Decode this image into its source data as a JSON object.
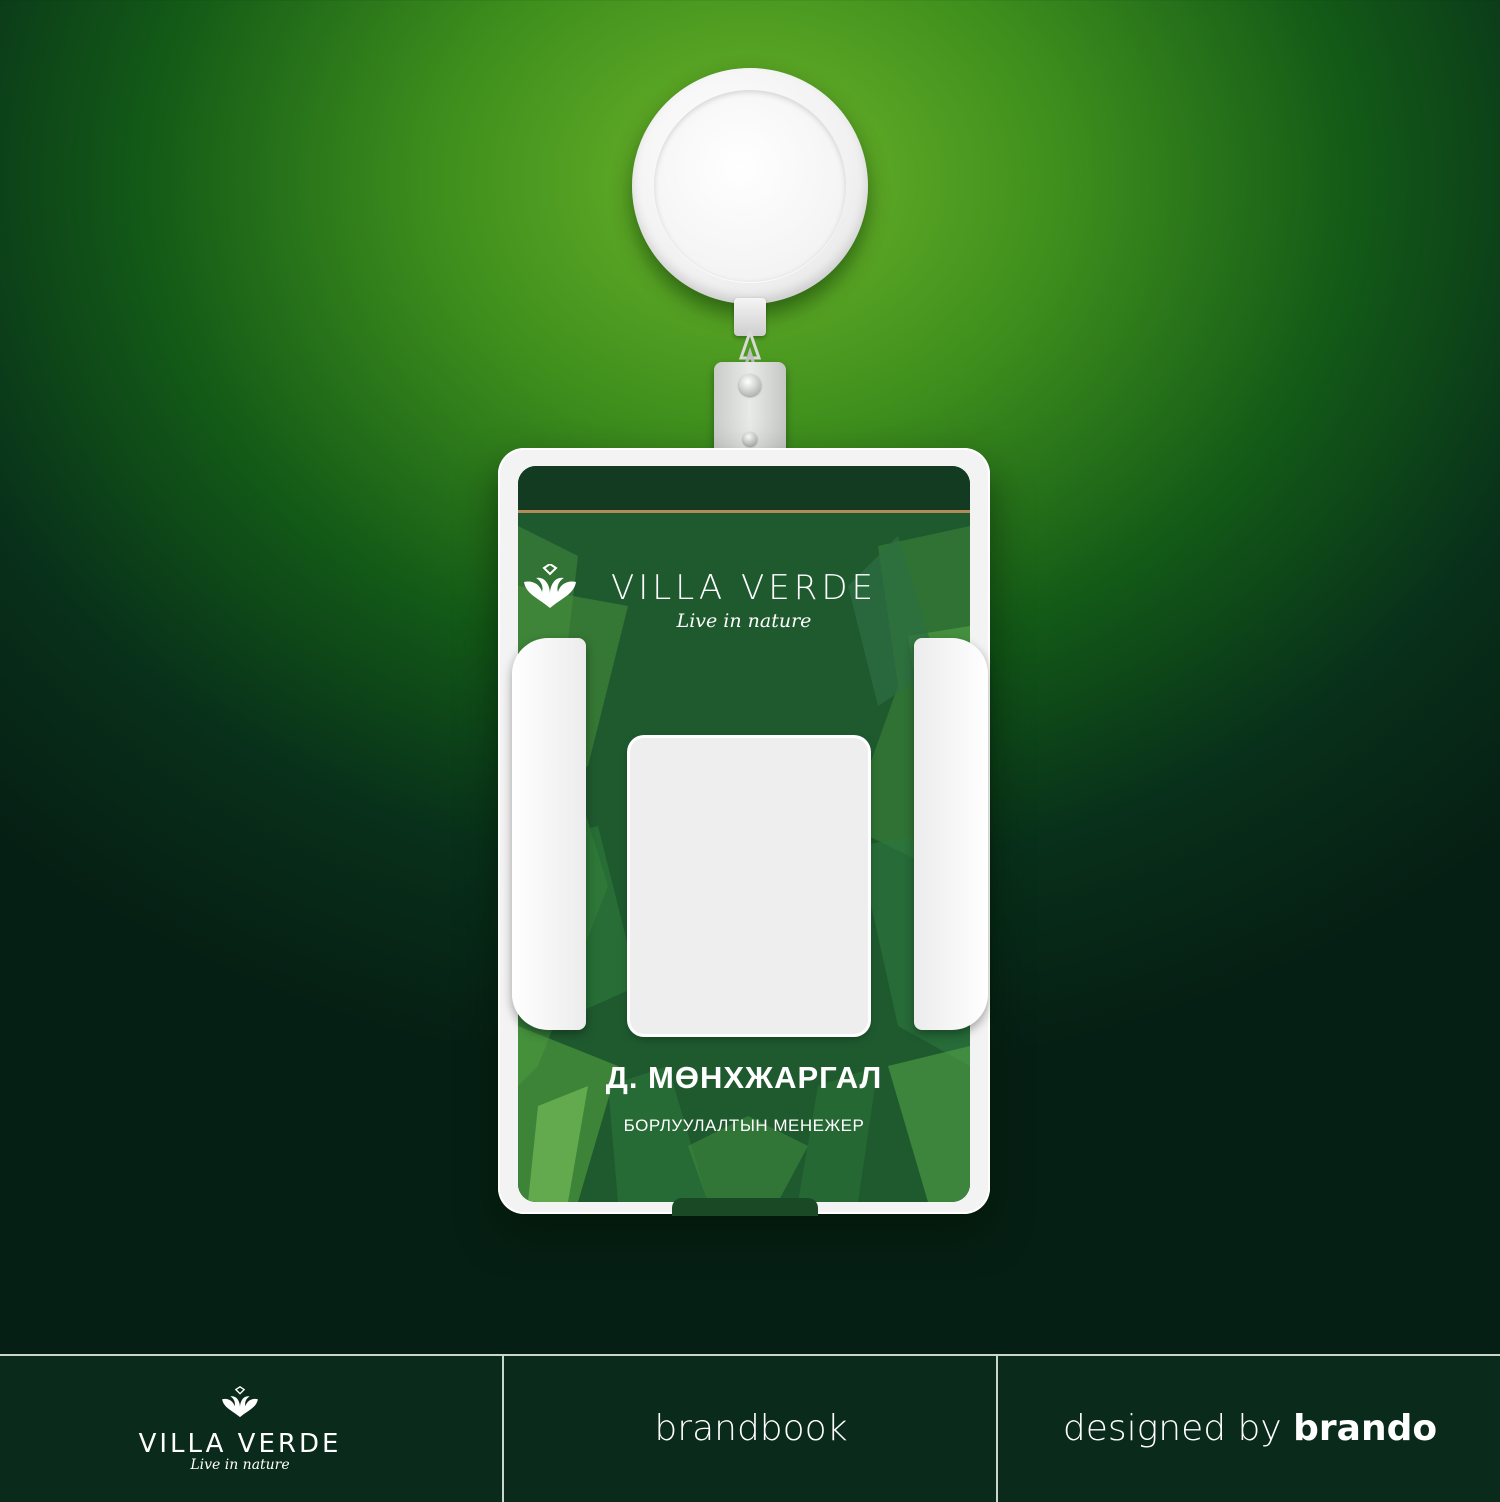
{
  "card": {
    "brand": "VILLA VERDE",
    "tagline": "Live in nature",
    "name": "Д. МӨНХЖАРГАЛ",
    "role": "БОРЛУУЛАЛТЫН МЕНЕЖЕР"
  },
  "footer": {
    "brand": "VILLA VERDE",
    "tagline": "Live in nature",
    "center_label": "brandbook",
    "credit_prefix": "designed by",
    "credit_name": "brando"
  },
  "colors": {
    "background_top": "#6db52a",
    "background_bottom": "#061f14",
    "card_green": "#1f5a2f",
    "accent_line": "#b48a5a",
    "footer_bg": "#0a2b1c",
    "text": "#ffffff"
  },
  "icons": {
    "brand_mark": "swan-diamond-icon"
  }
}
